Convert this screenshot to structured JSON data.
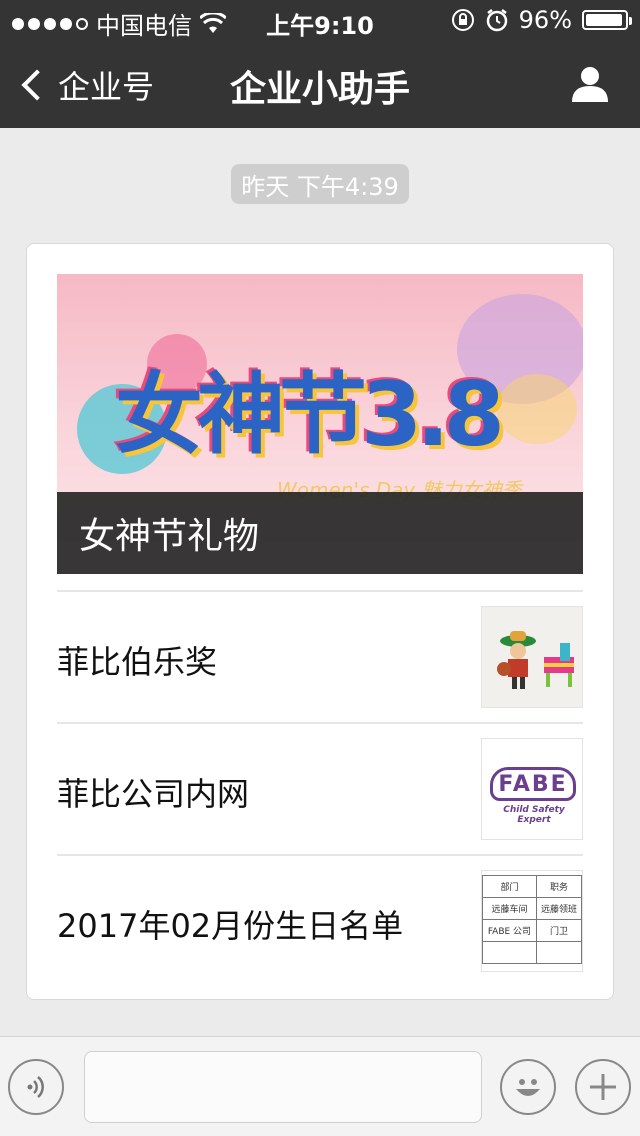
{
  "status_bar": {
    "carrier": "中国电信",
    "time": "上午9:10",
    "battery": "96%",
    "battery_level": 0.96
  },
  "nav": {
    "back_label": "企业号",
    "title": "企业小助手"
  },
  "timestamp": "昨天 下午4:39",
  "article_card": {
    "banner": {
      "caption": "女神节礼物",
      "art_text": "女神节3.8",
      "art_subtext": "Women's Day 魅力女神季"
    },
    "items": [
      {
        "label": "菲比伯乐奖"
      },
      {
        "label": "菲比公司内网"
      },
      {
        "label": "2017年02月份生日名单"
      }
    ]
  },
  "thumb_fabe": {
    "logo": "FABE",
    "sub": "Child Safety Expert"
  },
  "thumb_table": {
    "rows": [
      [
        "部门",
        "职务"
      ],
      [
        "远藤车间",
        "远藤领班"
      ],
      [
        "FABE 公司",
        "门卫"
      ],
      [
        "",
        ""
      ]
    ]
  },
  "input_bar": {
    "text_value": ""
  },
  "colors": {
    "nav_bg": "#343434",
    "page_bg": "#ebebeb"
  }
}
